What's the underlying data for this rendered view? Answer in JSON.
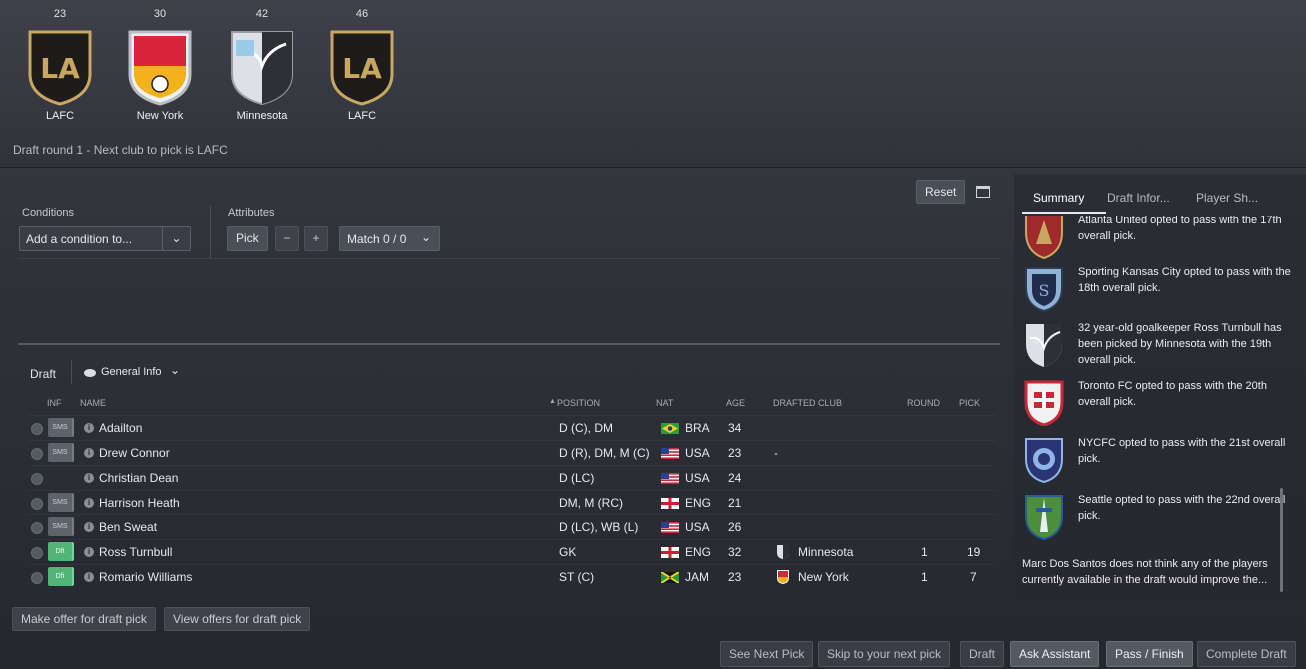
{
  "crests": [
    {
      "pick_no": "23",
      "club": "LAFC"
    },
    {
      "pick_no": "30",
      "club": "New York"
    },
    {
      "pick_no": "42",
      "club": "Minnesota"
    },
    {
      "pick_no": "46",
      "club": "LAFC"
    }
  ],
  "round_info": "Draft round 1 - Next club to pick is LAFC",
  "filters": {
    "reset_label": "Reset",
    "conditions_label": "Conditions",
    "add_condition_placeholder": "Add a condition to...",
    "attributes_label": "Attributes",
    "pick_label": "Pick",
    "minus": "−",
    "plus": "+",
    "match_label": "Match 0 / 0"
  },
  "table": {
    "draft_label": "Draft",
    "view_label": "General Info",
    "headers": {
      "inf": "INF",
      "name": "NAME",
      "position": "POSITION",
      "nat": "NAT",
      "age": "AGE",
      "drafted_club": "DRAFTED CLUB",
      "round": "ROUND",
      "pick": "PICK"
    },
    "rows": [
      {
        "tag": "SMS",
        "name": "Adailton",
        "position": "D (C), DM",
        "nat": "BRA",
        "age": "34",
        "drafted_club": "",
        "round": "",
        "pick": ""
      },
      {
        "tag": "SMS",
        "name": "Drew Connor",
        "position": "D (R), DM, M (C)",
        "nat": "USA",
        "age": "23",
        "drafted_club": "-",
        "round": "",
        "pick": ""
      },
      {
        "tag": "",
        "name": "Christian Dean",
        "position": "D (LC)",
        "nat": "USA",
        "age": "24",
        "drafted_club": "",
        "round": "",
        "pick": ""
      },
      {
        "tag": "SMS",
        "name": "Harrison Heath",
        "position": "DM, M (RC)",
        "nat": "ENG",
        "age": "21",
        "drafted_club": "",
        "round": "",
        "pick": ""
      },
      {
        "tag": "SMS",
        "name": "Ben Sweat",
        "position": "D (LC), WB (L)",
        "nat": "USA",
        "age": "26",
        "drafted_club": "",
        "round": "",
        "pick": ""
      },
      {
        "tag": "Dft",
        "name": "Ross Turnbull",
        "position": "GK",
        "nat": "ENG",
        "age": "32",
        "drafted_club": "Minnesota",
        "round": "1",
        "pick": "19"
      },
      {
        "tag": "Dft",
        "name": "Romario Williams",
        "position": "ST (C)",
        "nat": "JAM",
        "age": "23",
        "drafted_club": "New York",
        "round": "1",
        "pick": "7"
      }
    ]
  },
  "sidebar": {
    "tabs": [
      "Summary",
      "Draft Infor...",
      "Player Sh..."
    ],
    "feed": [
      {
        "club": "Atlanta United",
        "text": "Atlanta United opted to pass with the 17th overall pick."
      },
      {
        "club": "Sporting Kansas City",
        "text": "Sporting Kansas City opted to pass with the 18th overall pick."
      },
      {
        "club": "Minnesota",
        "text": "32 year-old goalkeeper Ross Turnbull has been picked by Minnesota with the 19th overall pick."
      },
      {
        "club": "Toronto FC",
        "text": "Toronto FC opted to pass with the 20th overall pick."
      },
      {
        "club": "NYCFC",
        "text": "NYCFC opted to pass with the 21st overall pick."
      },
      {
        "club": "Seattle",
        "text": "Seattle opted to pass with the 22nd overall pick."
      }
    ],
    "assistant_note": "Marc Dos Santos does not think any of the players currently available in the draft would improve the..."
  },
  "bottom": {
    "make_offer": "Make offer for draft pick",
    "view_offers": "View offers for draft pick",
    "see_next": "See Next Pick",
    "skip": "Skip to your next pick",
    "draft": "Draft",
    "ask": "Ask Assistant",
    "pass": "Pass / Finish",
    "complete": "Complete Draft"
  },
  "colors": {
    "accent_green": "#54b377",
    "lafc_gold": "#c9a761",
    "panel": "#2f3239"
  }
}
